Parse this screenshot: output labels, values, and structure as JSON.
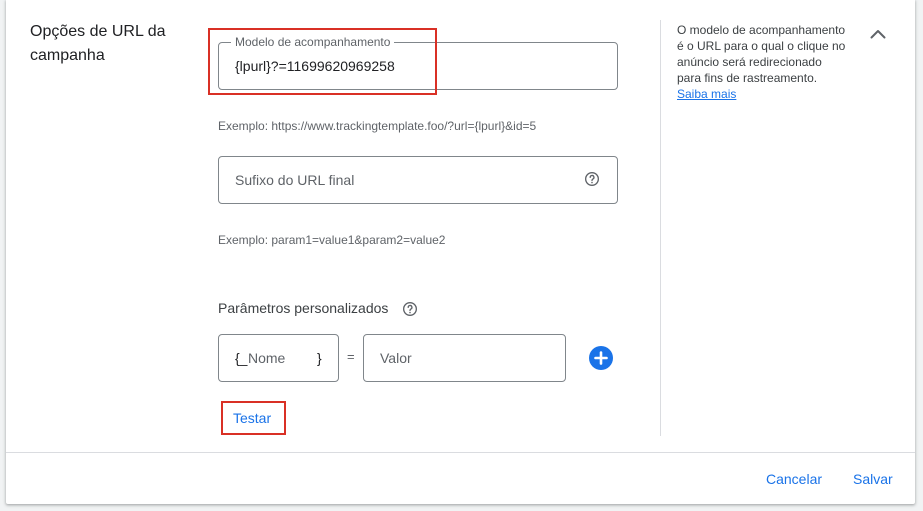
{
  "section": {
    "title": "Opções de URL da campanha"
  },
  "tracking_template": {
    "label": "Modelo de acompanhamento",
    "value": "{lpurl}?=11699620969258",
    "hint": "Exemplo: https://www.trackingtemplate.foo/?url={lpurl}&id=5"
  },
  "final_url_suffix": {
    "placeholder": "Sufixo do URL final",
    "hint": "Exemplo: param1=value1&param2=value2"
  },
  "custom_params": {
    "title": "Parâmetros personalizados",
    "name_prefix": "{_",
    "name_placeholder": "Nome",
    "name_suffix": "}",
    "equals": "=",
    "value_placeholder": "Valor"
  },
  "test_button": {
    "label": "Testar"
  },
  "side_help": {
    "text": "O modelo de acompanhamento é o URL para o qual o clique no anúncio será redirecionado para fins de rastreamento.",
    "link": "Saiba mais"
  },
  "footer": {
    "cancel": "Cancelar",
    "save": "Salvar"
  },
  "colors": {
    "accent": "#1a73e8",
    "highlight": "#d93025"
  },
  "icons": [
    "help-icon",
    "chevron-up-icon",
    "add-circle-icon"
  ]
}
